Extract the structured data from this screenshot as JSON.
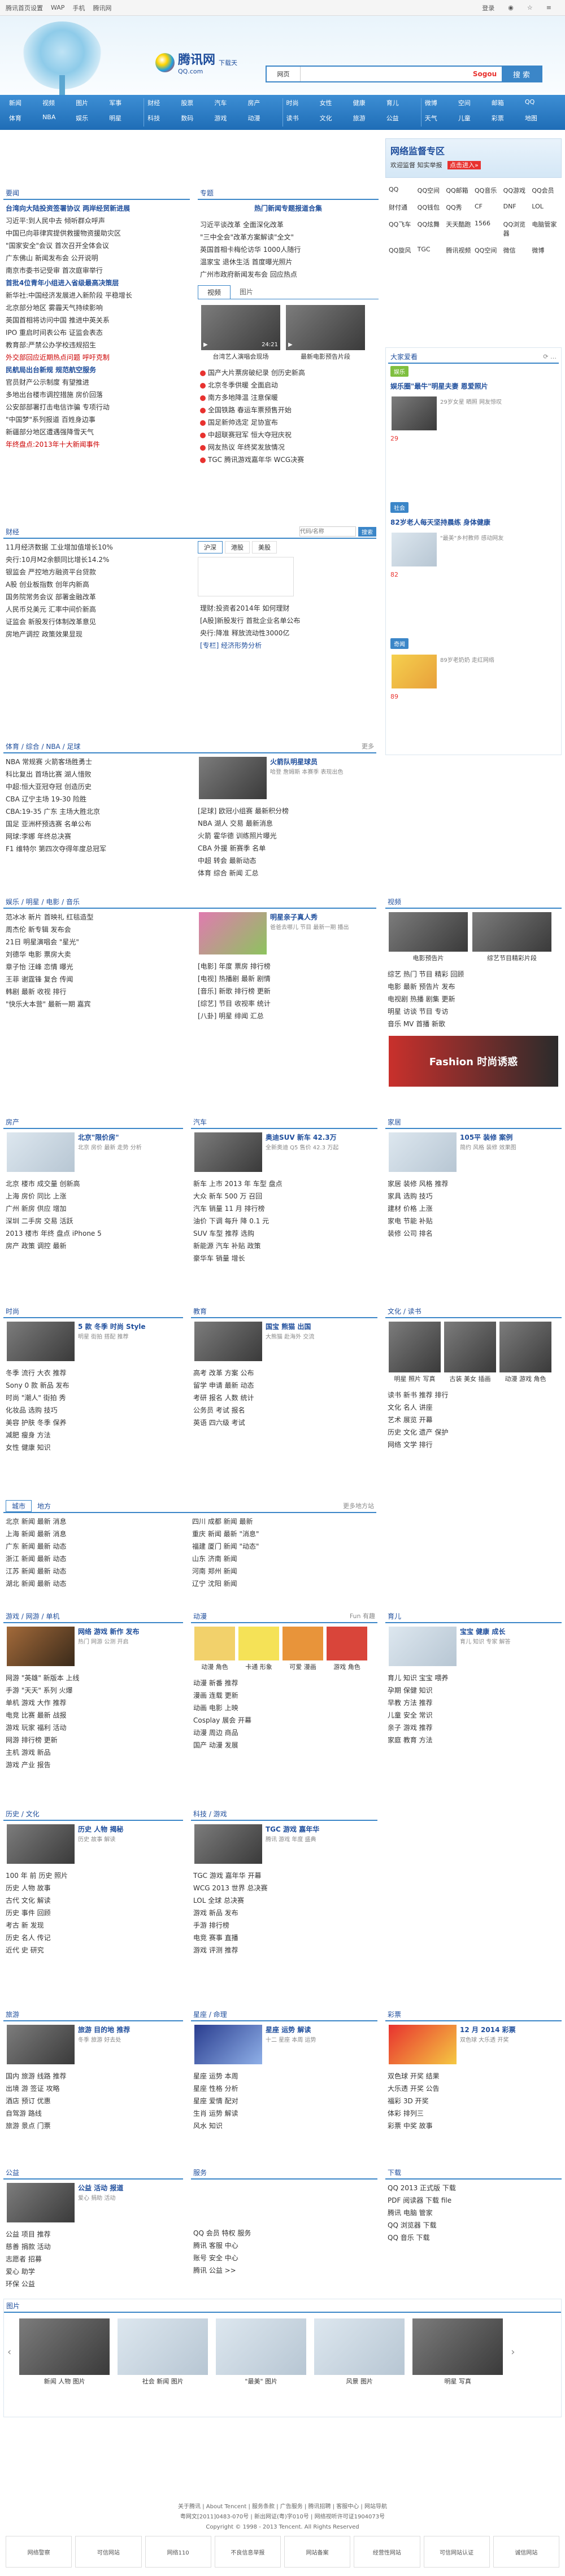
{
  "topbar": {
    "items": [
      "腾讯首页设置",
      "WAP",
      "手机",
      "腾讯网"
    ],
    "login": "登录",
    "qq_icon": "qq-icon"
  },
  "header": {
    "logo_main": "腾讯网",
    "logo_sub": "QQ.com",
    "logo_tag": "下载天",
    "search_select": "网页",
    "search_placeholder": "",
    "sogou": "Sogou",
    "search_button": "搜 索"
  },
  "nav": {
    "groups": [
      [
        "新闻",
        "视频",
        "图片",
        "军事",
        "体育",
        "NBA",
        "娱乐",
        "明星"
      ],
      [
        "财经",
        "股票",
        "汽车",
        "房产",
        "科技",
        "数码",
        "游戏",
        "动漫"
      ],
      [
        "时尚",
        "女性",
        "健康",
        "育儿",
        "读书",
        "文化",
        "旅游",
        "公益"
      ],
      [
        "微博",
        "空间",
        "邮箱",
        "QQ",
        "天气",
        "儿童",
        "彩票",
        "地图"
      ]
    ]
  },
  "news": {
    "title": "要闻",
    "items": [
      "台湾向大陆投资签署协议 两岸经贸新进展",
      "习近平:到人民中去 倾听群众呼声",
      "中国已向菲律宾提供救援物资援助灾区",
      "\"国家安全\"会议 首次召开全体会议",
      "广东佛山 新闻发布会 公开说明",
      "南京市委书记受审 首次庭审举行",
      "首批4位青年小组进入省级最高决策层",
      "新华社:中国经济发展进入新阶段 平稳增长",
      "北京部分地区 雾霾天气持续影响",
      "英国首相将访问中国 推进中英关系",
      "IPO 重启时间表公布 证监会表态",
      "教育部:严禁公办学校违规招生",
      "外交部回应近期热点问题 呼吁克制",
      "民航局出台新规 规范航空服务",
      "官员财产公示制度 有望推进",
      "多地出台楼市调控措施 房价回落",
      "公安部部署打击电信诈骗 专项行动",
      "\"中国梦\"系列报道 百姓身边事",
      "新疆部分地区遭遇强降雪天气",
      "年终盘点:2013年十大新闻事件"
    ]
  },
  "hot": {
    "title": "专题",
    "sub_title": "热门新闻专题报道合集",
    "items": [
      "习近平谈改革 全面深化改革",
      "\"三中全会\"改革方案解读\"全文\"",
      "英国首相卡梅伦访华 1000人随行",
      "温家宝 退休生活 首度曝光照片",
      "广州市政府新闻发布会 回应热点"
    ],
    "tabs": [
      "视频",
      "图片"
    ],
    "video1_cap": "台湾艺人演唱会现场",
    "video2_cap": "最新电影预告片段",
    "video_time": "24:21",
    "more_items": [
      "国产大片票房破纪录 创历史新高",
      "北京冬季供暖 全面启动",
      "南方多地降温 注意保暖",
      "全国铁路 春运车票预售开始",
      "国足新帅选定 足协宣布",
      "中超联赛冠军 恒大夺冠庆祝",
      "网友热议 年终奖发放情况",
      "TGC 腾讯游戏嘉年华 WCG决赛"
    ]
  },
  "sidebar": {
    "banner_title": "网络监督专区",
    "banner_sub": "欢迎监督 知实举报",
    "banner_btn": "点击进入»",
    "qq_links": [
      "QQ",
      "QQ空间",
      "QQ邮箱",
      "QQ音乐",
      "QQ游戏",
      "QQ会员",
      "财付通",
      "QQ钱包",
      "QQ秀",
      "CF",
      "DNF",
      "LOL",
      "QQ飞车",
      "QQ炫舞",
      "天天酷跑",
      "1566",
      "QQ浏览器",
      "电脑管家",
      "QQ旋风",
      "TGC",
      "腾讯视频",
      "QQ空间",
      "微信",
      "微博"
    ],
    "watch_title": "大家爱看",
    "watch_items": [
      "娱乐圈\"最牛\"明星夫妻 恩爱照片",
      "29岁女星 晒照 网友惊叹",
      "82岁老人每天坚持晨练 身体健康",
      "\"最美\"乡村教师 感动网友",
      "89岁老奶奶 走红网络"
    ],
    "watch_nums": [
      "29",
      "82",
      "89"
    ],
    "tag1": "娱乐",
    "tag2": "社会",
    "tag3": "奇闻"
  },
  "finance": {
    "title": "财经",
    "search_placeholder": "代码/名称",
    "search_btn": "搜索",
    "tabs": [
      "沪深",
      "港股",
      "美股"
    ],
    "items": [
      "11月经济数据 工业增加值增长10%",
      "央行:10月M2余额同比增长14.2%",
      "银监会 严控地方融资平台贷款",
      "A股 创业板指数 创年内新高",
      "国务院常务会议 部署金融改革",
      "人民币兑美元 汇率中间价新高",
      "证监会 新股发行体制改革意见",
      "房地产调控 政策效果显现"
    ],
    "right_items": [
      "理财:投资者2014年 如何理财",
      "[A股]新股发行 首批企业名单公布",
      "央行:降准 释放流动性3000亿",
      "[专栏] 经济形势分析"
    ]
  },
  "sports": {
    "title": "体育 / 综合 / NBA / 足球",
    "more": "更多",
    "items": [
      "NBA 常规赛 火箭客场胜勇士",
      "科比复出 首场比赛 湖人惜败",
      "中超:恒大亚冠夺冠 创造历史",
      "CBA 辽宁主场 19-30 险胜",
      "CBA:19-35 广东 主场大胜北京",
      "国足 亚洲杯预选赛 名单公布",
      "网球:李娜 年终总决赛",
      "F1 维特尔 第四次夺得年度总冠军"
    ],
    "feature_title": "火箭队明星球员",
    "feature_desc": "哈登 詹姆斯 本赛季 表现出色",
    "right_items": [
      "[足球] 欧冠小组赛 最新积分榜",
      "NBA 湖人 交易 最新消息",
      "火箭 霍华德 训练照片曝光",
      "CBA 外援 新赛季 名单",
      "中超 转会 最新动态",
      "体育 综合 新闻 汇总"
    ]
  },
  "ent": {
    "title": "娱乐 / 明星 / 电影 / 音乐",
    "items": [
      "范冰冰 新片 首映礼 红毯造型",
      "周杰伦 新专辑 发布会",
      "21日 明星演唱会 \"星光\"",
      "刘德华 电影 票房大卖",
      "章子怡 汪峰 恋情 曝光",
      "王菲 谢霆锋 复合 传闻",
      "韩剧 最新 收视 排行",
      "\"快乐大本营\" 最新一期 嘉宾"
    ],
    "feature_title": "明星亲子真人秀",
    "feature_desc": "爸爸去哪儿 节目 最新一期 播出",
    "right_items": [
      "[电影] 年度 票房 排行榜",
      "[电视] 热播剧 最新 剧情",
      "[音乐] 新歌 排行榜 更新",
      "[综艺] 节目 收视率 统计",
      "[八卦] 明星 绯闻 汇总"
    ],
    "side_title": "视频",
    "side_video1": "电影预告片",
    "side_video2": "综艺节目精彩片段",
    "side_items": [
      "综艺 热门 节目 精彩 回顾",
      "电影 最新 预告片 发布",
      "电视剧 热播 剧集 更新",
      "明星 访谈 节目 专访",
      "音乐 MV 首播 新歌"
    ],
    "fashion_ad": "Fashion 时尚诱惑"
  },
  "row3": {
    "house": {
      "title": "房产",
      "feature_title": "北京\"限价房\"",
      "feature_desc": "北京 房价 最新 走势 分析",
      "items": [
        "北京 楼市 成交量 创新高",
        "上海 房价 同比 上涨",
        "广州 新房 供应 增加",
        "深圳 二手房 交易 活跃",
        "2013 楼市 年终 盘点 iPhone 5",
        "房产 政策 调控 最新"
      ]
    },
    "auto": {
      "title": "汽车",
      "feature_title": "奥迪SUV 新车 42.3万",
      "feature_desc": "全新奥迪 Q5 售价 42.3 万起",
      "items": [
        "新车 上市 2013 年 车型 盘点",
        "大众 新车 500 万 召回",
        "汽车 销量 11 月 排行榜",
        "油价 下调 每升 降 0.1 元",
        "SUV 车型 推荐 选购",
        "新能源 汽车 补贴 政策",
        "豪华车 销量 增长"
      ]
    },
    "home": {
      "title": "家居",
      "feature_title": "105平 装修 案例",
      "feature_desc": "简约 风格 装修 效果图",
      "items": [
        "家居 装修 风格 推荐",
        "家具 选购 技巧",
        "建材 价格 上涨",
        "家电 节能 补贴",
        "装修 公司 排名"
      ]
    }
  },
  "row4": {
    "fashion": {
      "title": "时尚",
      "feature_title": "5 款 冬季 时尚 Style",
      "feature_desc": "明星 街拍 搭配 推荐",
      "items": [
        "冬季 流行 大衣 推荐",
        "Sony 0 款 新品 发布",
        "时尚 \"潮人\" 街拍 秀",
        "化妆品 选购 技巧",
        "美容 护肤 冬季 保养",
        "减肥 瘦身 方法",
        "女性 健康 知识"
      ]
    },
    "edu": {
      "title": "教育",
      "feature_title": "国宝 熊猫 出国",
      "feature_desc": "大熊猫 赴海外 交流",
      "items": [
        "高考 改革 方案 公布",
        "留学 申请 最新 动态",
        "考研 报名 人数 统计",
        "公务员 考试 报名",
        "英语 四六级 考试"
      ]
    },
    "culture": {
      "title": "文化 / 读书",
      "caps": [
        "明星 照片 写真",
        "古装 美女 插画",
        "动漫 游戏 角色"
      ],
      "items": [
        "读书 新书 推荐 排行",
        "文化 名人 讲座",
        "艺术 展览 开幕",
        "历史 文化 遗产 保护",
        "网络 文学 排行"
      ]
    }
  },
  "row5": {
    "tabs": [
      "城市",
      "地方"
    ],
    "more": "更多地方站",
    "items": [
      "北京 新闻 最新 消息",
      "上海 新闻 最新 消息",
      "广东 新闻 最新 动态",
      "浙江 新闻 最新 动态",
      "江苏 新闻 最新 动态",
      "湖北 新闻 最新 动态"
    ],
    "right_items": [
      "四川 成都 新闻 最新",
      "重庆 新闻 最新 \"消息\"",
      "福建 厦门 新闻 \"动态\"",
      "山东 济南 新闻",
      "河南 郑州 新闻",
      "辽宁 沈阳 新闻"
    ]
  },
  "row6": {
    "game": {
      "title": "游戏 / 网游 / 单机",
      "feature_title": "网络 游戏 新作 发布",
      "feature_desc": "热门 网游 公测 开启",
      "items": [
        "网游 \"英雄\" 新版本 上线",
        "手游 \"天天\" 系列 火爆",
        "单机 游戏 大作 推荐",
        "电竞 比赛 最新 战报",
        "游戏 玩家 福利 活动",
        "网游 排行榜 更新",
        "主机 游戏 新品",
        "游戏 产业 报告"
      ]
    },
    "comic": {
      "title": "动漫",
      "more": "Fun 有趣",
      "caps": [
        "动漫 角色",
        "卡通 形象",
        "可爱 漫画",
        "游戏 角色"
      ],
      "items": [
        "动漫 新番 推荐",
        "漫画 连载 更新",
        "动画 电影 上映",
        "Cosplay 展会 开幕",
        "动漫 周边 商品",
        "国产 动漫 发展"
      ]
    },
    "baby": {
      "title": "育儿",
      "feature_title": "宝宝 健康 成长",
      "feature_desc": "育儿 知识 专家 解答",
      "items": [
        "育儿 知识 宝宝 喂养",
        "孕期 保健 知识",
        "早教 方法 推荐",
        "儿童 安全 常识",
        "亲子 游戏 推荐",
        "家庭 教育 方法"
      ]
    }
  },
  "row7": {
    "history": {
      "title": "历史 / 文化",
      "feature_title": "历史 人物 揭秘",
      "feature_desc": "历史 故事 解读",
      "items": [
        "100 年 前 历史 照片",
        "历史 人物 故事",
        "古代 文化 解读",
        "历史 事件 回顾",
        "考古 新 发现",
        "历史 名人 传记",
        "近代 史 研究"
      ]
    },
    "tech": {
      "title": "科技 / 游戏",
      "feature_title": "TGC 游戏 嘉年华",
      "feature_desc": "腾讯 游戏 年度 盛典",
      "items": [
        "TGC 游戏 嘉年华 开幕",
        "WCG 2013 世界 总决赛",
        "LOL 全球 总决赛",
        "游戏 新品 发布",
        "手游 排行榜",
        "电竞 赛事 直播",
        "游戏 评测 推荐"
      ]
    }
  },
  "row8": {
    "col1": {
      "title": "旅游",
      "feature_title": "旅游 目的地 推荐",
      "feature_desc": "冬季 旅游 好去处",
      "items": [
        "国内 旅游 线路 推荐",
        "出境 游 签证 攻略",
        "酒店 预订 优惠",
        "自驾游 路线",
        "旅游 景点 门票"
      ]
    },
    "col2": {
      "title": "星座 / 命理",
      "feature_title": "星座 运势 解读",
      "feature_desc": "十二 星座 本周 运势",
      "items": [
        "星座 运势 本周",
        "星座 性格 分析",
        "星座 爱情 配对",
        "生肖 运势 解读",
        "风水 知识"
      ]
    },
    "col3": {
      "title": "彩票",
      "feature_title": "12 月 2014 彩票",
      "feature_desc": "双色球 大乐透 开奖",
      "items": [
        "双色球 开奖 结果",
        "大乐透 开奖 公告",
        "福彩 3D 开奖",
        "体彩 排列三",
        "彩票 中奖 故事"
      ]
    }
  },
  "row9": {
    "col1": {
      "title": "公益",
      "feature_title": "公益 活动 报道",
      "feature_desc": "爱心 捐助 活动",
      "items": [
        "公益 项目 推荐",
        "慈善 捐款 活动",
        "志愿者 招募",
        "爱心 助学",
        "环保 公益"
      ]
    },
    "col2": {
      "title": "服务",
      "items": [
        "QQ 会员 特权 服务",
        "腾讯 客服 中心",
        "账号 安全 中心",
        "腾讯 公益 >>"
      ]
    },
    "col3": {
      "title": "下载",
      "items": [
        "QQ 2013 正式版 下载",
        "PDF 阅读器 下载 file",
        "腾讯 电脑 管家",
        "QQ 浏览器 下载",
        "QQ 音乐 下载"
      ]
    }
  },
  "gallery": {
    "title": "图片",
    "caps": [
      "新闻 人物 图片",
      "社会 新闻 图片",
      "\"最美\" 图片",
      "风景 图片",
      "明星 写真"
    ]
  },
  "footer": {
    "line1": "关于腾讯 | About Tencent | 服务条款 | 广告服务 | 腾讯招聘 | 客服中心 | 网站导航",
    "line2": "粤网文[2011]0483-070号 | 新出网证(粤)字010号 | 网络视听许可证1904073号",
    "line3": "Copyright © 1998 - 2013 Tencent. All Rights Reserved",
    "bottom": [
      "网络警察",
      "可信网站",
      "网络110",
      "不良信息举报",
      "网站备案",
      "经营性网站",
      "可信网站认证",
      "诚信网站"
    ]
  }
}
